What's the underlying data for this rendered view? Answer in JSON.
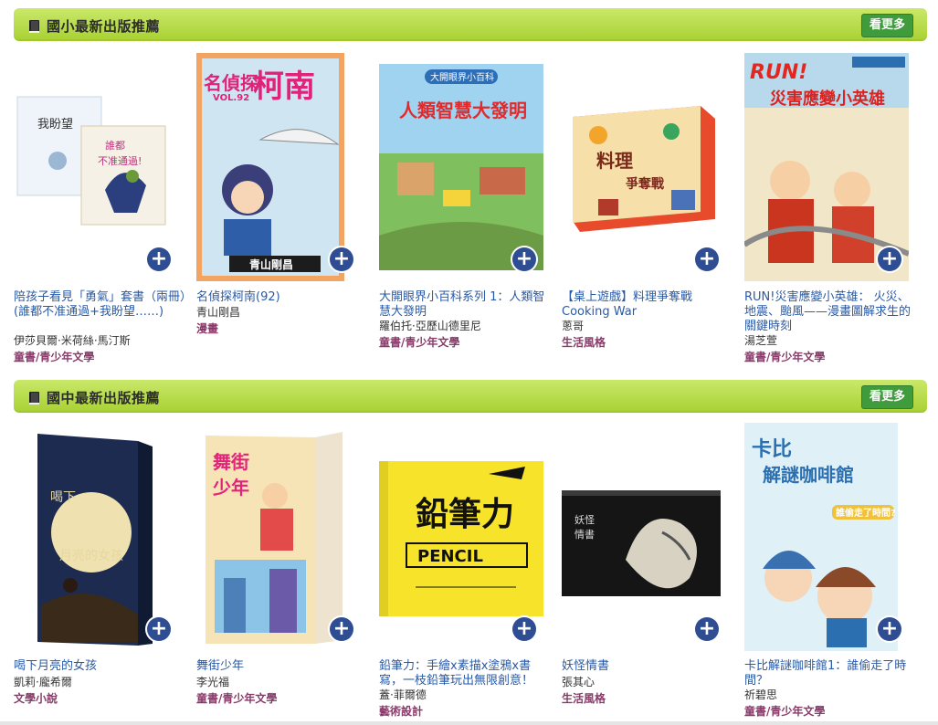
{
  "sections": [
    {
      "title": "國小最新出版推薦",
      "more_label": "看更多",
      "items": [
        {
          "title": "陪孩子看見「勇氣」套書（兩冊）(誰都不准通過+我盼望……)",
          "author": "伊莎貝爾·米荷絲·馬汀斯",
          "category": "童書/青少年文學",
          "cover_title": "我盼望 / 誰都不准通過!"
        },
        {
          "title": "名偵探柯南(92)",
          "author": "青山剛昌",
          "category": "漫畫",
          "cover_title": "名偵探柯南 VOL.92",
          "cover_author": "青山剛昌"
        },
        {
          "title": "大開眼界小百科系列 1：人類智慧大發明",
          "author": "羅伯托·亞歷山德里尼",
          "category": "童書/青少年文學",
          "cover_title": "人類智慧大發明",
          "cover_series": "大開眼界小百科"
        },
        {
          "title": "【桌上遊戲】料理爭奪戰 Cooking War",
          "author": "蔥哥",
          "category": "生活風格",
          "cover_title": "料理爭奪戰"
        },
        {
          "title": "RUN!災害應變小英雄： 火災、地震、颱風——漫畫圖解求生的關鍵時刻",
          "author": "湯芝萱",
          "category": "童書/青少年文學",
          "cover_title": "災害應變小英雄",
          "cover_run": "RUN!"
        }
      ]
    },
    {
      "title": "國中最新出版推薦",
      "more_label": "看更多",
      "items": [
        {
          "title": "喝下月亮的女孩",
          "author": "凱莉·龐希爾",
          "category": "文學小說",
          "cover_title": "喝下月亮的女孩"
        },
        {
          "title": "舞街少年",
          "author": "李光福",
          "category": "童書/青少年文學",
          "cover_title": "舞街少年"
        },
        {
          "title": "鉛筆力：手繪x素描x塗鴉x書寫，一枝鉛筆玩出無限創意！",
          "author": "蓋·菲爾德",
          "category": "藝術設計",
          "cover_title": "鉛筆力",
          "cover_sub": "PENCIL"
        },
        {
          "title": "妖怪情書",
          "author": "張其心",
          "category": "生活風格",
          "cover_title": "妖怪情書"
        },
        {
          "title": "卡比解謎咖啡館1：誰偷走了時間？",
          "author": "祈碧思",
          "category": "童書/青少年文學",
          "cover_title": "卡比解謎咖啡館",
          "cover_sub": "誰偷走了時間?"
        }
      ]
    }
  ],
  "plus_label": "+"
}
